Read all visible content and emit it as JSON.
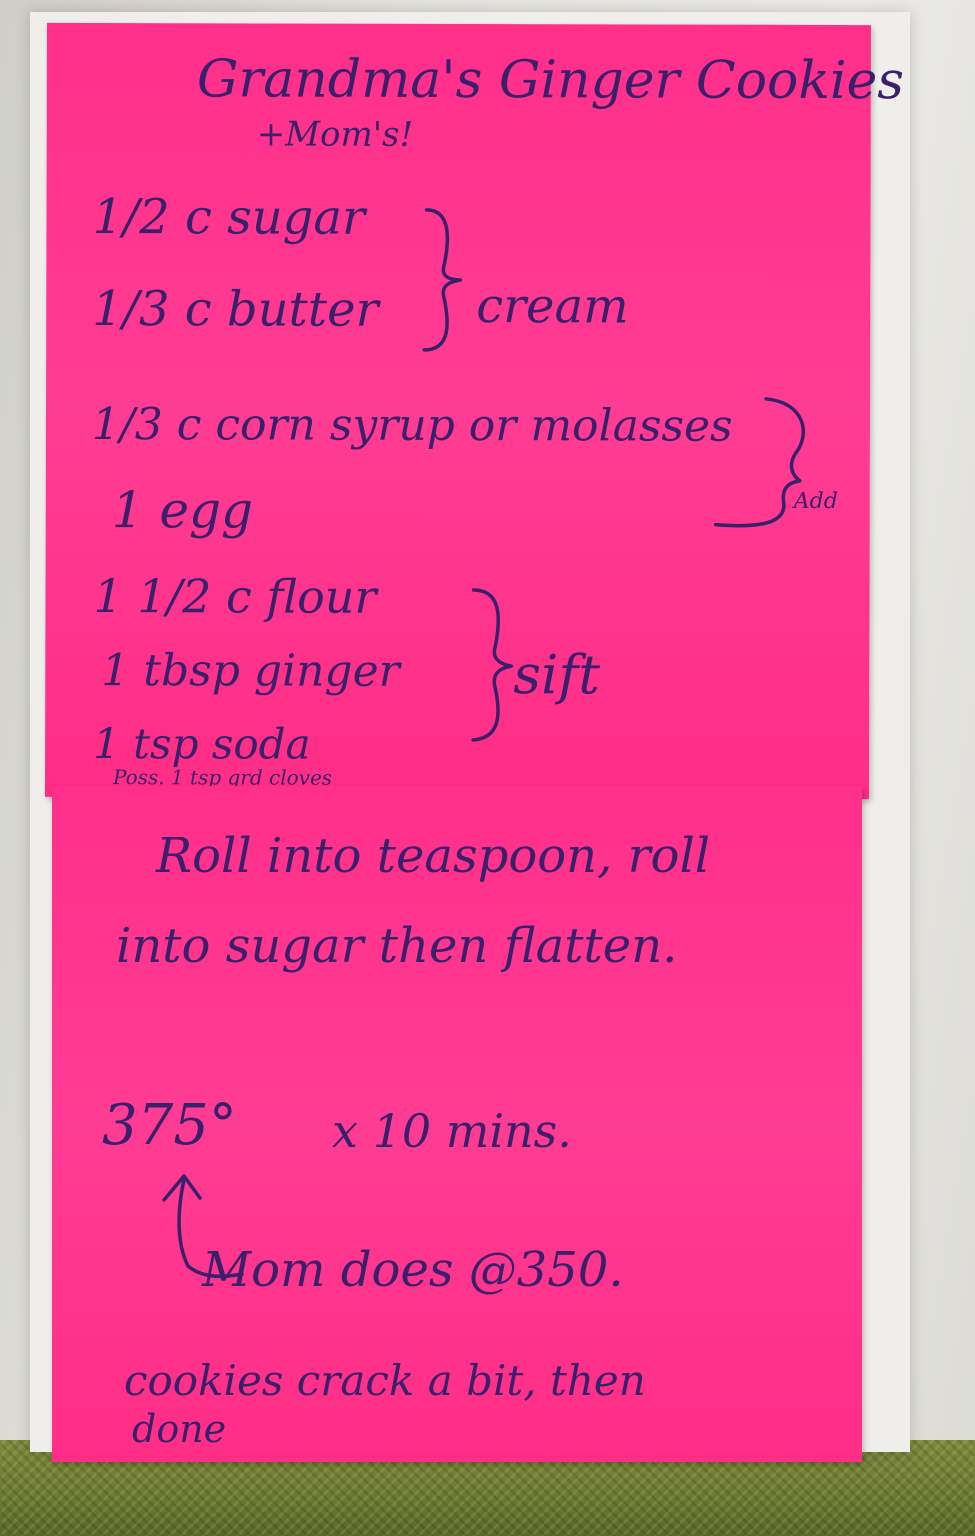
{
  "note_top": {
    "title": "Grandma's Ginger Cookies",
    "subtitle": "+Mom's!",
    "ingredients": [
      "1/2 c sugar",
      "1/3 c butter",
      "1/3 c corn syrup or molasses",
      "1 egg",
      "1 1/2 c flour",
      "1 tbsp ginger",
      "1 tsp soda"
    ],
    "bracket_cream": "cream",
    "bracket_add": "Add",
    "bracket_sift": "sift",
    "footnote": "Poss. 1 tsp grd cloves"
  },
  "note_bottom": {
    "line1": "Roll into teaspoon, roll",
    "line2": "into sugar then flatten.",
    "temp": "375°",
    "time": "x 10 mins.",
    "mom_note": "Mom does @350.",
    "done_line1": "cookies crack a bit, then",
    "done_line2": "done"
  },
  "colors": {
    "note_pink": "#ff3c93",
    "ink": "#3a1f6b",
    "mat_green": "#6c7a2f"
  }
}
